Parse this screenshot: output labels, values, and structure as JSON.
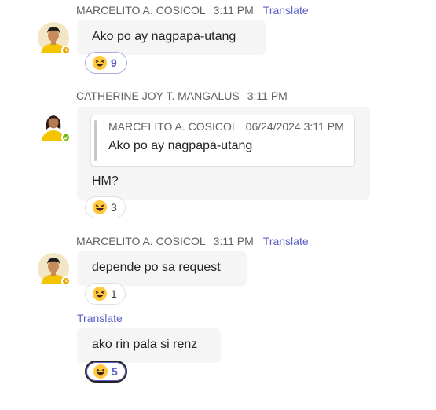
{
  "messages": [
    {
      "sender": "MARCELITO A. COSICOL",
      "time": "3:11 PM",
      "translate": "Translate",
      "text": "Ako po ay nagpapa-utang",
      "reaction": {
        "count": "9"
      },
      "presence": "away"
    },
    {
      "sender": "CATHERINE JOY T. MANGALUS",
      "time": "3:11 PM",
      "quote": {
        "sender": "MARCELITO A. COSICOL",
        "timestamp": "06/24/2024 3:11 PM",
        "text": "Ako po ay nagpapa-utang"
      },
      "text": "HM?",
      "reaction": {
        "count": "3"
      },
      "presence": "available"
    },
    {
      "sender": "MARCELITO A. COSICOL",
      "time": "3:11 PM",
      "translate": "Translate",
      "text": "depende po sa request",
      "reaction": {
        "count": "1"
      },
      "presence": "away"
    },
    {
      "translate": "Translate",
      "text": "ako rin pala si renz",
      "reaction": {
        "count": "5"
      }
    }
  ],
  "colors": {
    "accent": "#5b5fc7",
    "bubble": "#f5f5f5",
    "presence_away": "#eaa300",
    "presence_available": "#6bb700"
  },
  "icons": {
    "reaction_emoji": "laughing-face-icon",
    "presence_away": "clock-icon",
    "presence_available": "checkmark-icon"
  }
}
